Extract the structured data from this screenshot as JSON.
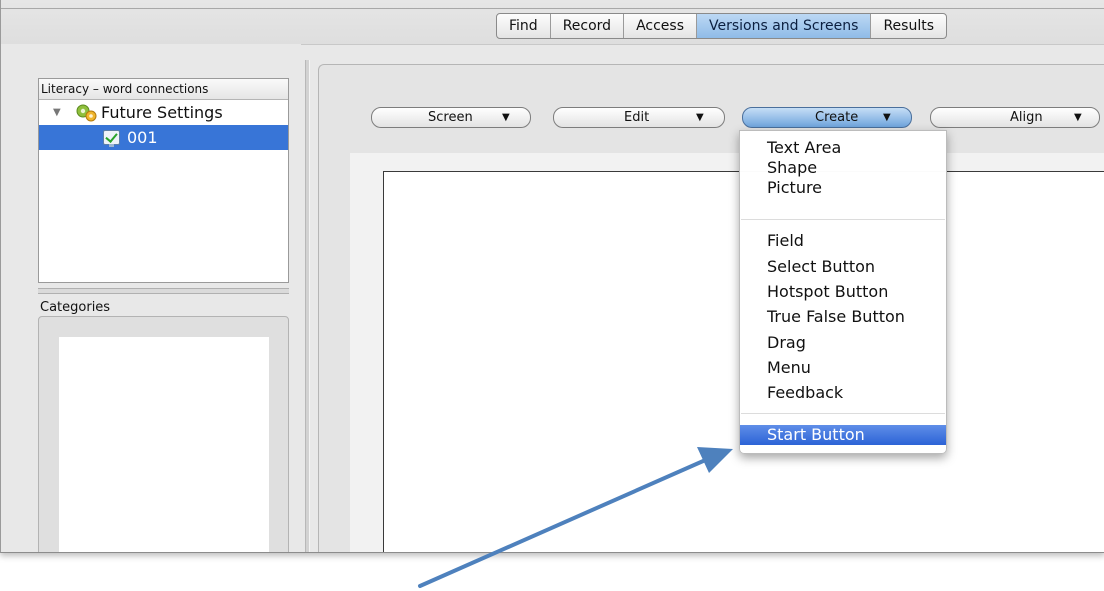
{
  "tabs": [
    {
      "label": "Find",
      "selected": false
    },
    {
      "label": "Record",
      "selected": false
    },
    {
      "label": "Access",
      "selected": false
    },
    {
      "label": "Versions and Screens",
      "selected": true
    },
    {
      "label": "Results",
      "selected": false
    }
  ],
  "sidebar": {
    "tree_header": "Literacy – word connections",
    "tree": {
      "root_label": "Future Settings",
      "child_label": "001"
    },
    "categories_title": "Categories"
  },
  "toolbar": {
    "screen_label": "Screen",
    "edit_label": "Edit",
    "create_label": "Create",
    "align_label": "Align"
  },
  "menu": {
    "group1": [
      "Text Area",
      "Shape",
      "Picture"
    ],
    "group2": [
      "Field",
      "Select Button",
      "Hotspot Button",
      "True False Button",
      "Drag",
      "Menu",
      "Feedback"
    ],
    "group3": [
      "Start Button"
    ],
    "highlighted": "Start Button"
  },
  "colors": {
    "selection_blue": "#3875d7",
    "arrow": "#4e81bd"
  },
  "icons": {
    "dropdown": "triangle-down-icon",
    "disclosure": "triangle-down-icon",
    "settings": "gears-icon",
    "screen": "screen-check-icon"
  }
}
